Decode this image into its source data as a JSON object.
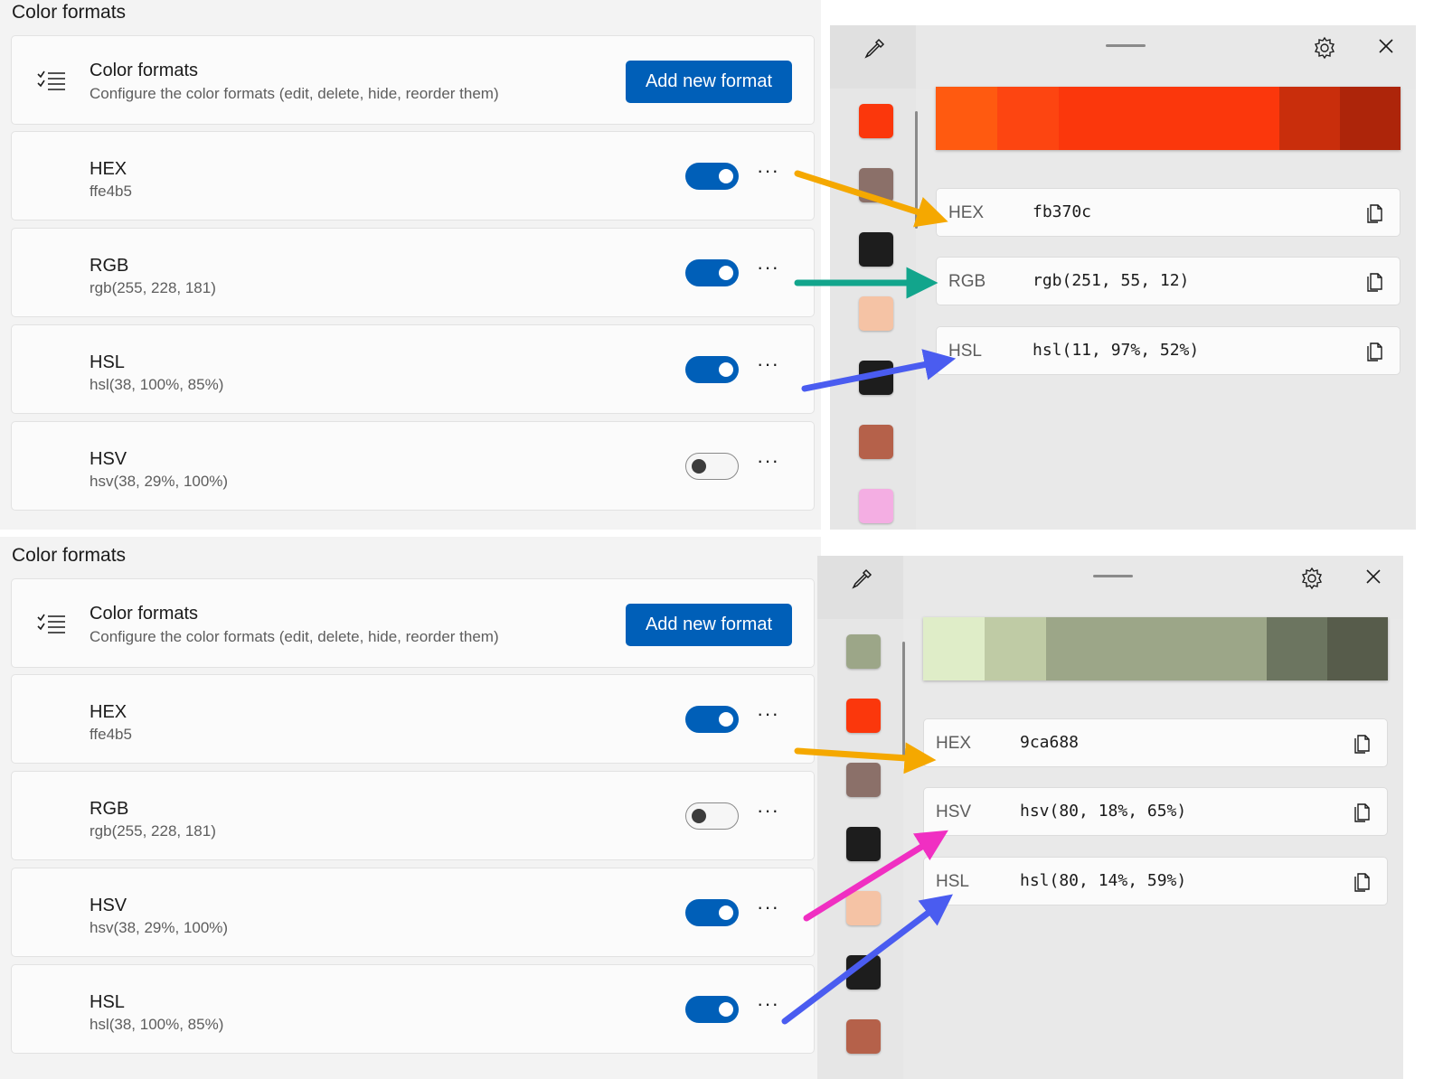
{
  "top": {
    "section_title": "Color formats",
    "header_card": {
      "title": "Color formats",
      "subtitle": "Configure the color formats (edit, delete, hide, reorder them)",
      "button": "Add new format"
    },
    "formats": [
      {
        "name": "HEX",
        "example": "ffe4b5",
        "enabled": true
      },
      {
        "name": "RGB",
        "example": "rgb(255, 228, 181)",
        "enabled": true
      },
      {
        "name": "HSL",
        "example": "hsl(38, 100%, 85%)",
        "enabled": true
      },
      {
        "name": "HSV",
        "example": "hsv(38, 29%, 100%)",
        "enabled": false
      }
    ],
    "more_label": "···",
    "picker": {
      "gradient": [
        "#ff5a10",
        "#fd4511",
        "#fb370c",
        "#fb370c",
        "#fb370c",
        "#fb370c",
        "#c92e0c",
        "#ad250a"
      ],
      "history": [
        "#fb370c",
        "#8b7069",
        "#1d1d1d",
        "#f5c3a5",
        "#1d1d1d",
        "#b5614a",
        "#f4aee3"
      ],
      "values": [
        {
          "label": "HEX",
          "value": "fb370c"
        },
        {
          "label": "RGB",
          "value": "rgb(251, 55, 12)"
        },
        {
          "label": "HSL",
          "value": "hsl(11, 97%, 52%)"
        }
      ]
    }
  },
  "bottom": {
    "section_title": "Color formats",
    "header_card": {
      "title": "Color formats",
      "subtitle": "Configure the color formats (edit, delete, hide, reorder them)",
      "button": "Add new format"
    },
    "formats": [
      {
        "name": "HEX",
        "example": "ffe4b5",
        "enabled": true
      },
      {
        "name": "RGB",
        "example": "rgb(255, 228, 181)",
        "enabled": false
      },
      {
        "name": "HSV",
        "example": "hsv(38, 29%, 100%)",
        "enabled": true
      },
      {
        "name": "HSL",
        "example": "hsl(38, 100%, 85%)",
        "enabled": true
      }
    ],
    "more_label": "···",
    "picker": {
      "gradient": [
        "#dfedc8",
        "#bfcba5",
        "#9ca688",
        "#9ca688",
        "#9ca688",
        "#9ca688",
        "#6c7560",
        "#575c4b"
      ],
      "history": [
        "#9ca688",
        "#fb370c",
        "#8b7069",
        "#1d1d1d",
        "#f5c3a5",
        "#1d1d1d",
        "#b5614a"
      ],
      "values": [
        {
          "label": "HEX",
          "value": "9ca688"
        },
        {
          "label": "HSV",
          "value": "hsv(80, 18%, 65%)"
        },
        {
          "label": "HSL",
          "value": "hsl(80, 14%, 59%)"
        }
      ]
    }
  },
  "colors": {
    "accent": "#005fb8",
    "arrow_hex": "#f5a800",
    "arrow_rgb": "#12a58c",
    "arrow_hsl": "#4a5cf0",
    "arrow_hsv": "#f02fc2"
  }
}
